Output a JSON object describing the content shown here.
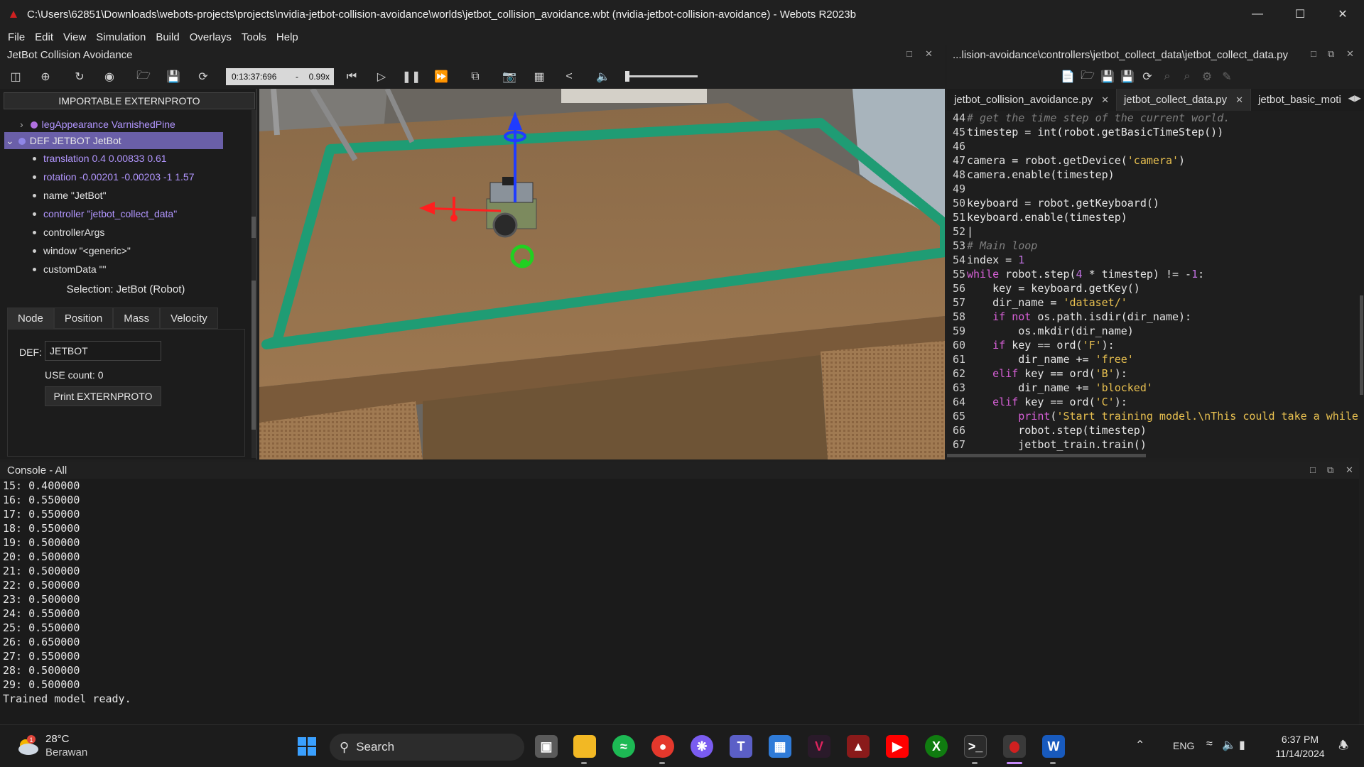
{
  "window": {
    "title": "C:\\Users\\62851\\Downloads\\webots-projects\\projects\\nvidia-jetbot-collision-avoidance\\worlds\\jetbot_collision_avoidance.wbt (nvidia-jetbot-collision-avoidance) - Webots R2023b"
  },
  "menu": [
    "File",
    "Edit",
    "View",
    "Simulation",
    "Build",
    "Overlays",
    "Tools",
    "Help"
  ],
  "scene": {
    "title": "JetBot Collision Avoidance",
    "time": "0:13:37:696",
    "time_sep": "-",
    "speed": "0.99x"
  },
  "tree": {
    "extern_button": "IMPORTABLE EXTERNPROTO",
    "items": [
      "legAppearance VarnishedPine",
      "DEF JETBOT JetBot",
      "translation 0.4 0.00833 0.61",
      "rotation -0.00201 -0.00203 -1 1.57",
      "name \"JetBot\"",
      "controller \"jetbot_collect_data\"",
      "controllerArgs",
      "window \"<generic>\"",
      "customData \"\""
    ]
  },
  "selection": {
    "title": "Selection: JetBot (Robot)",
    "tabs": [
      "Node",
      "Position",
      "Mass",
      "Velocity"
    ],
    "def_label": "DEF:",
    "def_value": "JETBOT",
    "use_count": "USE count: 0",
    "print_button": "Print EXTERNPROTO"
  },
  "editor": {
    "path": "...lision-avoidance\\controllers\\jetbot_collect_data\\jetbot_collect_data.py",
    "tabs": [
      "jetbot_collision_avoidance.py",
      "jetbot_collect_data.py",
      "jetbot_basic_moti"
    ]
  },
  "console": {
    "title": "Console - All",
    "lines": [
      "15: 0.400000",
      "16: 0.550000",
      "17: 0.550000",
      "18: 0.550000",
      "19: 0.500000",
      "20: 0.500000",
      "21: 0.500000",
      "22: 0.500000",
      "23: 0.500000",
      "24: 0.550000",
      "25: 0.550000",
      "26: 0.650000",
      "27: 0.550000",
      "28: 0.500000",
      "29: 0.500000",
      "Trained model ready."
    ]
  },
  "taskbar": {
    "weather_temp": "28°C",
    "weather_cond": "Berawan",
    "weather_badge": "1",
    "search": "Search",
    "lang": "ENG",
    "time": "6:37 PM",
    "date": "11/14/2024"
  },
  "colors": {
    "accent_purple": "#b296ff",
    "selected_row": "#6a5fa8",
    "track_green": "#1f9c74"
  }
}
